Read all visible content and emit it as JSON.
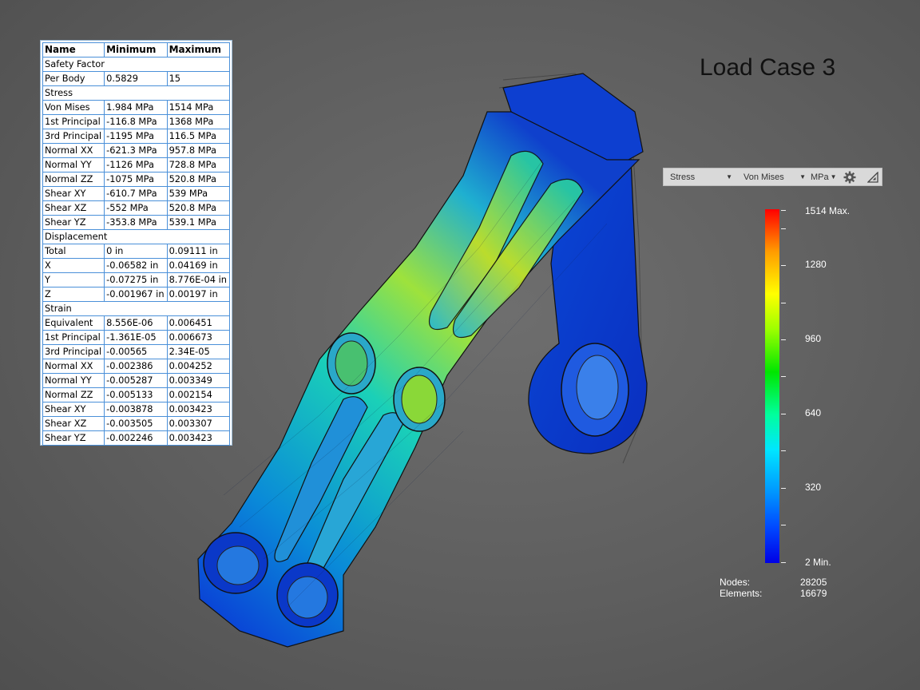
{
  "title": "Load Case 3",
  "table": {
    "headers": [
      "Name",
      "Minimum",
      "Maximum"
    ],
    "rows": [
      {
        "section": "Safety Factor"
      },
      {
        "name": "Per Body",
        "min": "0.5829",
        "max": "15"
      },
      {
        "section": "Stress"
      },
      {
        "name": "Von Mises",
        "min": "1.984 MPa",
        "max": "1514 MPa"
      },
      {
        "name": "1st Principal",
        "min": "-116.8 MPa",
        "max": "1368 MPa"
      },
      {
        "name": "3rd Principal",
        "min": "-1195 MPa",
        "max": "116.5 MPa"
      },
      {
        "name": "Normal XX",
        "min": "-621.3 MPa",
        "max": "957.8 MPa"
      },
      {
        "name": "Normal YY",
        "min": "-1126 MPa",
        "max": "728.8 MPa"
      },
      {
        "name": "Normal ZZ",
        "min": "-1075 MPa",
        "max": "520.8 MPa"
      },
      {
        "name": "Shear XY",
        "min": "-610.7 MPa",
        "max": "539 MPa"
      },
      {
        "name": "Shear XZ",
        "min": "-552 MPa",
        "max": "520.8 MPa"
      },
      {
        "name": "Shear YZ",
        "min": "-353.8 MPa",
        "max": "539.1 MPa"
      },
      {
        "section": "Displacement"
      },
      {
        "name": "Total",
        "min": "0 in",
        "max": "0.09111 in"
      },
      {
        "name": "X",
        "min": "-0.06582 in",
        "max": "0.04169 in"
      },
      {
        "name": "Y",
        "min": "-0.07275 in",
        "max": "8.776E-04 in"
      },
      {
        "name": "Z",
        "min": "-0.001967 in",
        "max": "0.00197 in"
      },
      {
        "section": "Strain"
      },
      {
        "name": "Equivalent",
        "min": "8.556E-06",
        "max": "0.006451"
      },
      {
        "name": "1st Principal",
        "min": "-1.361E-05",
        "max": "0.006673"
      },
      {
        "name": "3rd Principal",
        "min": "-0.00565",
        "max": "2.34E-05"
      },
      {
        "name": "Normal XX",
        "min": "-0.002386",
        "max": "0.004252"
      },
      {
        "name": "Normal YY",
        "min": "-0.005287",
        "max": "0.003349"
      },
      {
        "name": "Normal ZZ",
        "min": "-0.005133",
        "max": "0.002154"
      },
      {
        "name": "Shear XY",
        "min": "-0.003878",
        "max": "0.003423"
      },
      {
        "name": "Shear XZ",
        "min": "-0.003505",
        "max": "0.003307"
      },
      {
        "name": "Shear YZ",
        "min": "-0.002246",
        "max": "0.003423"
      }
    ]
  },
  "toolbar": {
    "result_type": "Stress",
    "component": "Von Mises",
    "units": "MPa",
    "settings_icon": "gear-icon",
    "scale_icon": "triangle-ruler-icon"
  },
  "legend": {
    "labels": [
      "1514 Max.",
      "1280",
      "960",
      "640",
      "320",
      "2 Min."
    ]
  },
  "stats": {
    "nodes_label": "Nodes:",
    "nodes_value": "28205",
    "elements_label": "Elements:",
    "elements_value": "16679"
  }
}
